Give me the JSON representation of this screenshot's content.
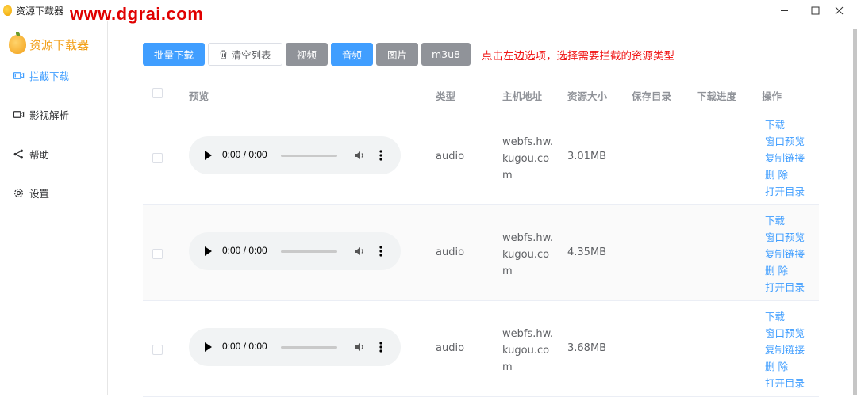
{
  "window": {
    "title": "资源下载器",
    "watermark": "www.dgrai.com"
  },
  "sidebar": {
    "logo_text": "资源下载器",
    "items": [
      {
        "label": "拦截下载",
        "icon": "video-camera-icon",
        "active": true
      },
      {
        "label": "影视解析",
        "icon": "video-camera-outline-icon",
        "active": false
      },
      {
        "label": "帮助",
        "icon": "share-icon",
        "active": false
      },
      {
        "label": "设置",
        "icon": "gear-icon",
        "active": false
      }
    ]
  },
  "toolbar": {
    "batch_download": "批量下载",
    "clear_list": "清空列表",
    "types": [
      "视频",
      "音频",
      "图片",
      "m3u8"
    ],
    "active_type": "音频",
    "hint": "点击左边选项，选择需要拦截的资源类型"
  },
  "table": {
    "headers": {
      "preview": "预览",
      "type": "类型",
      "host": "主机地址",
      "size": "资源大小",
      "dir": "保存目录",
      "progress": "下载进度",
      "op": "操作"
    },
    "rows": [
      {
        "time": "0:00 / 0:00",
        "type": "audio",
        "host": "webfs.hw.kugou.com",
        "size": "3.01MB",
        "dir": "",
        "progress": ""
      },
      {
        "time": "0:00 / 0:00",
        "type": "audio",
        "host": "webfs.hw.kugou.com",
        "size": "4.35MB",
        "dir": "",
        "progress": ""
      },
      {
        "time": "0:00 / 0:00",
        "type": "audio",
        "host": "webfs.hw.kugou.com",
        "size": "3.68MB",
        "dir": "",
        "progress": ""
      }
    ],
    "ops": [
      "下载",
      "窗口预览",
      "复制链接",
      "删 除",
      "打开目录"
    ]
  },
  "colors": {
    "primary": "#409eff",
    "info": "#909399",
    "hint": "#f01414",
    "logo": "#f2a01a"
  }
}
